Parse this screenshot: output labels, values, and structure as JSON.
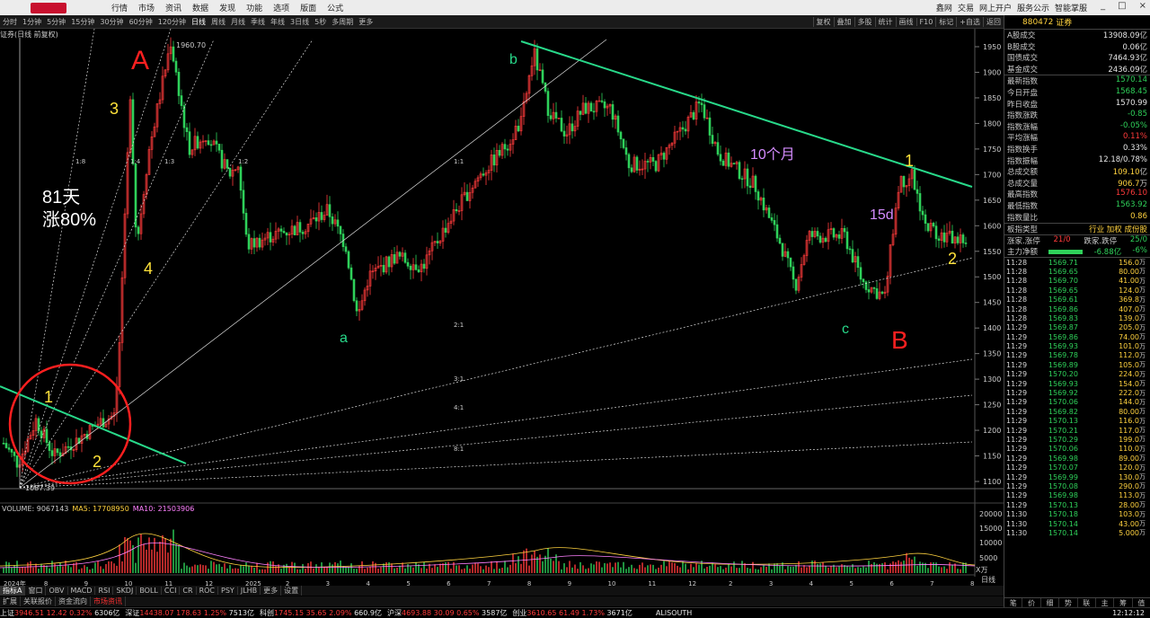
{
  "title_bar": {
    "menus": [
      "行情",
      "市场",
      "资讯",
      "数据",
      "发现",
      "功能",
      "选项",
      "版面",
      "公式"
    ],
    "right_links": [
      "鑫网",
      "交易",
      "网上开户",
      "服务公示",
      "智能掌服"
    ],
    "window_controls": [
      "_",
      "□",
      "×"
    ]
  },
  "periods": [
    "分时",
    "1分钟",
    "5分钟",
    "15分钟",
    "30分钟",
    "60分钟",
    "120分钟",
    "日线",
    "周线",
    "月线",
    "季线",
    "年线",
    "3日线",
    "5秒",
    "多周期",
    "更多"
  ],
  "active_period": "日线",
  "toolbar_right": [
    "复权",
    "叠加",
    "多股",
    "统计",
    "画线",
    "F10",
    "标记",
    "+自选",
    "返回"
  ],
  "chart_label": "证券(日线 前复权)",
  "y_axis": [
    "1950",
    "1900",
    "1850",
    "1800",
    "1750",
    "1700",
    "1650",
    "1600",
    "1550",
    "1500",
    "1450",
    "1400",
    "1350",
    "1300",
    "1250",
    "1200",
    "1150",
    "1100"
  ],
  "price_marks": {
    "high": "1960.70",
    "low": "1087.39"
  },
  "annotations": {
    "A": "A",
    "B": "B",
    "a": "a",
    "b": "b",
    "c": "c",
    "n3": "3",
    "n4": "4",
    "n1_left": "1",
    "n2_left": "2",
    "n1_right": "1",
    "n2_right": "2",
    "days": "81天",
    "rise": "涨80%",
    "months": "10个月",
    "d15": "15d"
  },
  "fan_labels": [
    "1:8",
    "1:4",
    "1:3",
    "1:2",
    "1:1",
    "2:1",
    "3:1",
    "4:1",
    "8:1"
  ],
  "x_axis": [
    "2024年",
    "8",
    "9",
    "10",
    "11",
    "12",
    "2025",
    "2",
    "3",
    "4",
    "5",
    "6",
    "7",
    "8",
    "9",
    "10",
    "11",
    "12",
    "2",
    "3",
    "4",
    "5",
    "6",
    "7",
    "8"
  ],
  "volume": {
    "label": "VOLUME: 9067143",
    "ma5": "MA5: 17708950",
    "ma10": "MA10: 21503906",
    "y_axis": [
      "20000",
      "15000",
      "10000",
      "5000"
    ],
    "unit": "X万"
  },
  "indicator_tabs": [
    "指标A",
    "窗口",
    "OBV",
    "MACD",
    "RSI",
    "SKDJ",
    "BOLL",
    "CCI",
    "CR",
    "ROC",
    "PSY",
    "JLHB",
    "更多",
    "设置"
  ],
  "bottom_tabs": [
    "扩展",
    "关联报价",
    "资金流向",
    "市场资讯"
  ],
  "status_bar": [
    {
      "name": "上证",
      "price": "3946.51",
      "chg": "12.42",
      "pct": "0.32%",
      "amt": "6306亿",
      "dir": "up"
    },
    {
      "name": "深证",
      "price": "14438.07",
      "chg": "178.63",
      "pct": "1.25%",
      "amt": "7513亿",
      "dir": "up"
    },
    {
      "name": "科创",
      "price": "1745.15",
      "chg": "35.65",
      "pct": "2.09%",
      "amt": "660.9亿",
      "dir": "up"
    },
    {
      "name": "沪深",
      "price": "4693.88",
      "chg": "30.09",
      "pct": "0.65%",
      "amt": "3587亿",
      "dir": "up"
    },
    {
      "name": "创业",
      "price": "3610.65",
      "chg": "61.49",
      "pct": "1.73%",
      "amt": "3671亿",
      "dir": "up"
    }
  ],
  "status_extra": "ALISOUTH",
  "clock": "12:12:12",
  "right_panel": {
    "code": "880472",
    "name": "证券",
    "rows1": [
      {
        "l": "A股成交",
        "v": "13908.09",
        "u": "亿",
        "c": "wht"
      },
      {
        "l": "B股成交",
        "v": "0.06",
        "u": "亿",
        "c": "wht"
      },
      {
        "l": "国债成交",
        "v": "7464.93",
        "u": "亿",
        "c": "wht"
      },
      {
        "l": "基金成交",
        "v": "2436.09",
        "u": "亿",
        "c": "wht"
      }
    ],
    "rows2": [
      {
        "l": "最新指数",
        "v": "1570.14",
        "c": "grn"
      },
      {
        "l": "今日开盘",
        "v": "1568.45",
        "c": "grn"
      },
      {
        "l": "昨日收盘",
        "v": "1570.99",
        "c": "wht"
      },
      {
        "l": "指数涨跌",
        "v": "-0.85",
        "c": "grn"
      },
      {
        "l": "指数涨幅",
        "v": "-0.05%",
        "c": "grn"
      },
      {
        "l": "平均涨幅",
        "v": "0.11%",
        "c": "red"
      },
      {
        "l": "指数换手",
        "v": "0.33%",
        "c": "wht"
      },
      {
        "l": "指数振幅",
        "v": "12.18/0.78%",
        "c": "wht"
      },
      {
        "l": "总成交额",
        "v": "109.10",
        "u": "亿",
        "c": "yel"
      },
      {
        "l": "总成交量",
        "v": "906.7",
        "u": "万",
        "c": "yel"
      },
      {
        "l": "最高指数",
        "v": "1576.10",
        "c": "red"
      },
      {
        "l": "最低指数",
        "v": "1563.92",
        "c": "grn"
      },
      {
        "l": "指数量比",
        "v": "0.86",
        "c": "yel"
      }
    ],
    "board_row": {
      "l": "板指类型",
      "v": "行业 加权 成份股"
    },
    "up_down": {
      "l1": "涨家.涨停",
      "v1": "21/0",
      "l2": "跌家.跌停",
      "v2": "25/0"
    },
    "net_flow": {
      "l": "主力净额",
      "v": "-6.88亿",
      "pct": "-6%"
    },
    "ticks": [
      [
        "11:28",
        "1569.71",
        "156.0"
      ],
      [
        "11:28",
        "1569.65",
        "80.00"
      ],
      [
        "11:28",
        "1569.70",
        "41.00"
      ],
      [
        "11:28",
        "1569.65",
        "124.0"
      ],
      [
        "11:28",
        "1569.61",
        "369.8"
      ],
      [
        "11:28",
        "1569.86",
        "407.0"
      ],
      [
        "11:28",
        "1569.83",
        "139.0"
      ],
      [
        "11:29",
        "1569.87",
        "205.0"
      ],
      [
        "11:29",
        "1569.86",
        "74.00"
      ],
      [
        "11:29",
        "1569.93",
        "101.0"
      ],
      [
        "11:29",
        "1569.78",
        "112.0"
      ],
      [
        "11:29",
        "1569.89",
        "105.0"
      ],
      [
        "11:29",
        "1570.20",
        "224.0"
      ],
      [
        "11:29",
        "1569.93",
        "154.0"
      ],
      [
        "11:29",
        "1569.92",
        "222.0"
      ],
      [
        "11:29",
        "1570.06",
        "144.0"
      ],
      [
        "11:29",
        "1569.82",
        "80.00"
      ],
      [
        "11:29",
        "1570.13",
        "116.0"
      ],
      [
        "11:29",
        "1570.21",
        "117.0"
      ],
      [
        "11:29",
        "1570.29",
        "199.0"
      ],
      [
        "11:29",
        "1570.06",
        "110.0"
      ],
      [
        "11:29",
        "1569.98",
        "89.00"
      ],
      [
        "11:29",
        "1570.07",
        "120.0"
      ],
      [
        "11:29",
        "1569.99",
        "130.0"
      ],
      [
        "11:29",
        "1570.08",
        "290.0"
      ],
      [
        "11:29",
        "1569.98",
        "113.0"
      ],
      [
        "11:29",
        "1570.13",
        "28.00"
      ],
      [
        "11:30",
        "1570.18",
        "103.0"
      ],
      [
        "11:30",
        "1570.14",
        "43.00"
      ],
      [
        "11:30",
        "1570.14",
        "5.000"
      ]
    ],
    "tick_unit": "万",
    "foot_tabs": [
      "笔",
      "价",
      "细",
      "势",
      "联",
      "主",
      "筹",
      "值"
    ]
  },
  "side_tabs": [
    "日线",
    "指标",
    "模板"
  ],
  "colors": {
    "up": "#ff3b3b",
    "down": "#2fd15a",
    "trend": "#28d98a",
    "annotA": "#ff2020",
    "annotYellow": "#ffe23a",
    "annotPurple": "#d58cff"
  }
}
